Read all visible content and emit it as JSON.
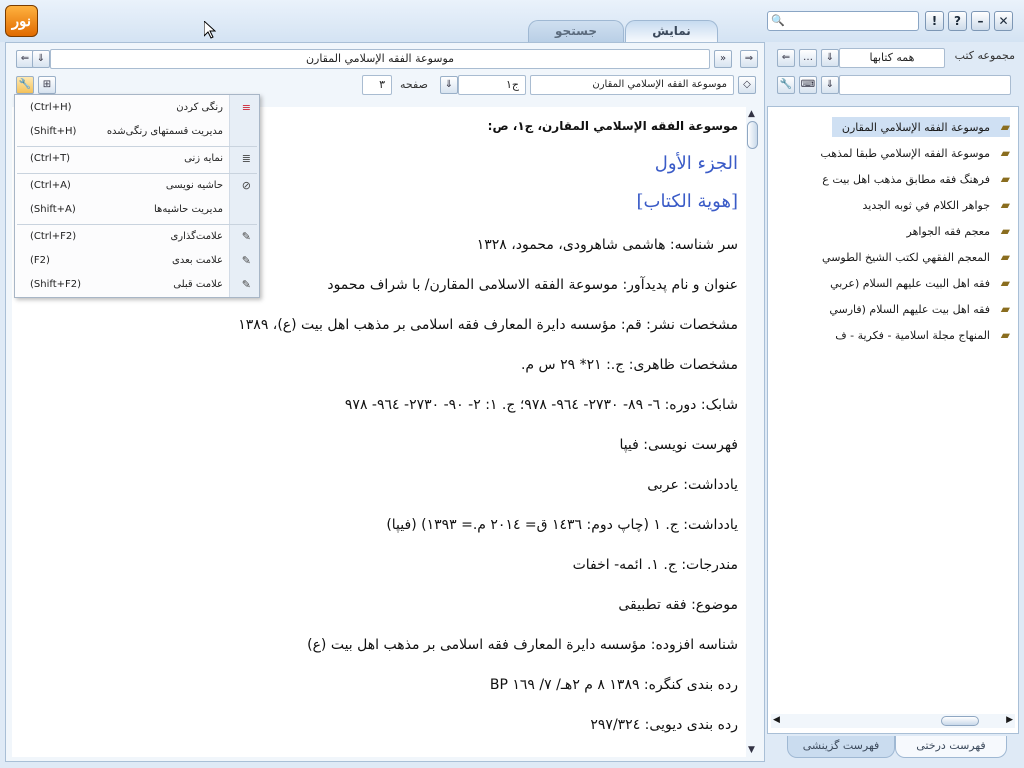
{
  "tabs": {
    "display": "نمایش",
    "search": "جستجو"
  },
  "window": {
    "buttons": [
      "!",
      "?",
      "–",
      "✕"
    ]
  },
  "logo_text": "نور",
  "main": {
    "title_field": "موسوعة الفقه الإسلامي المقارن",
    "book_field": "موسوعة الفقه الإسلامي المقارن",
    "volume_field": "ج١",
    "page_label": "صفحه",
    "page_value": "٣"
  },
  "menu": {
    "items": [
      {
        "label": "رنگی کردن",
        "shortcut": "(Ctrl+H)",
        "icon": "highlight-icon"
      },
      {
        "label": "مدیریت قسمتهای رنگی‌شده",
        "shortcut": "(Shift+H)",
        "icon": ""
      },
      {
        "label": "نمایه زنی",
        "shortcut": "(Ctrl+T)",
        "icon": "index-icon"
      },
      {
        "label": "حاشیه نویسی",
        "shortcut": "(Ctrl+A)",
        "icon": "clip-icon"
      },
      {
        "label": "مدیریت حاشیه‌ها",
        "shortcut": "(Shift+A)",
        "icon": ""
      },
      {
        "label": "علامت‌گذاری",
        "shortcut": "(Ctrl+F2)",
        "icon": "bookmark-icon"
      },
      {
        "label": "علامت بعدی",
        "shortcut": "(F2)",
        "icon": "bookmark-next-icon"
      },
      {
        "label": "علامت قبلی",
        "shortcut": "(Shift+F2)",
        "icon": "bookmark-prev-icon"
      }
    ]
  },
  "content": {
    "title": "موسوعة الفقه الإسلامي المقارن، ج١، ص:",
    "heading1": "الجزء الأول",
    "heading2": "[هوية الكتاب]",
    "lines": [
      "سر شناسه: هاشمی شاهرودی، محمود، ١٣٢٨",
      "عنوان و نام پدیدآور: موسوعة الفقه الاسلامی المقارن/ با شراف محمود",
      "مشخصات نشر: قم: مؤسسه دایرة المعارف فقه اسلامی بر مذهب اهل بیت (ع)، ١٣٨٩",
      "مشخصات ظاهری: ج.: ٢١* ٢٩ س م.",
      "شابک: دوره: ٦- ٨٩- ٢٧٣٠- ٩٦٤- ٩٧٨؛ ج. ١: ٢- ٩٠- ٢٧٣٠- ٩٦٤- ٩٧٨",
      "فهرست نویسی: فیپا",
      "یادداشت: عربی",
      "یادداشت: ج. ١ (چاپ دوم: ١٤٣٦ ق= ٢٠١٤ م.= ١٣٩٣) (فیپا)",
      "مندرجات: ج. ١. ائمه- اخفات",
      "موضوع: فقه تطبیقی",
      "شناسه افزوده: مؤسسه دایرة المعارف فقه اسلامی بر مذهب اهل بیت (ع)",
      "رده بندی کنگره: ١٣٨٩ ٨ م ٢هـ/ ٧/ ١٦٩ BP",
      "رده بندی دیویی: ٢٩٧/٣٢٤"
    ]
  },
  "sidebar": {
    "collection_label": "مجموعه کتب",
    "collection_value": "همه کتابها",
    "tree": [
      "موسوعة الفقه الإسلامي المقارن",
      "موسوعة الفقه الإسلامي طبقا لمذهب",
      "فرهنگ فقه مطابق مذهب اهل بیت ع",
      "جواهر الكلام في ثوبه الجديد",
      "معجم فقه الجواهر",
      "المعجم الفقهي لكتب الشيخ الطوسي",
      "فقه اهل البيت عليهم السلام (عربي",
      "فقه اهل بيت عليهم السلام (فارسي",
      "المنهاج مجلة اسلامية - فكرية - ف"
    ],
    "bottom_tabs": {
      "tree": "فهرست درختی",
      "select": "فهرست گزینشی"
    }
  }
}
